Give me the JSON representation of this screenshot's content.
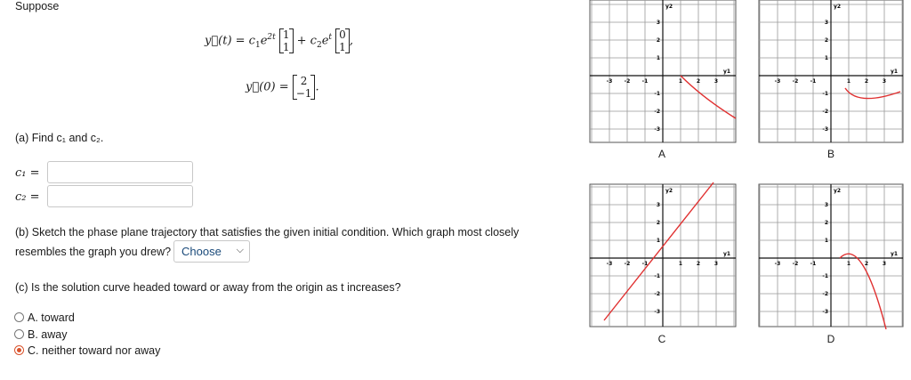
{
  "problem": {
    "intro": "Suppose",
    "eq1": {
      "lhs": "y⃗(t) = c",
      "term1_exp": "2t",
      "term2_coef": "+ c",
      "term2_exp": "t",
      "vec1": [
        "1",
        "1"
      ],
      "vec2": [
        "0",
        "1"
      ]
    },
    "eq2": {
      "lhs": "y⃗(0) =",
      "vec": [
        "2",
        "−1"
      ]
    },
    "part_a": "(a) Find c₁ and c₂.",
    "c1_label": "c₁ =",
    "c2_label": "c₂ =",
    "c1_value": "",
    "c2_value": "",
    "part_b_line1": "(b) Sketch the phase plane trajectory that satisfies the given initial condition. Which graph most closely",
    "part_b_line2": "resembles the graph you drew?",
    "choose_label": "Choose",
    "part_c": "(c) Is the solution curve headed toward or away from the origin as t increases?",
    "options": [
      {
        "letter": "A.",
        "text": "toward",
        "selected": false
      },
      {
        "letter": "B.",
        "text": "away",
        "selected": false
      },
      {
        "letter": "C.",
        "text": "neither toward nor away",
        "selected": true
      }
    ]
  },
  "graphs": {
    "y_axis_label": "y2",
    "x_axis_label": "y1",
    "x_ticks": [
      "-3",
      "-2",
      "-1",
      "1",
      "2",
      "3"
    ],
    "y_ticks": [
      "3",
      "2",
      "1",
      "-1",
      "-2",
      "-3"
    ],
    "labels": [
      "A",
      "B",
      "C",
      "D"
    ],
    "curve_color": "#e03030"
  }
}
